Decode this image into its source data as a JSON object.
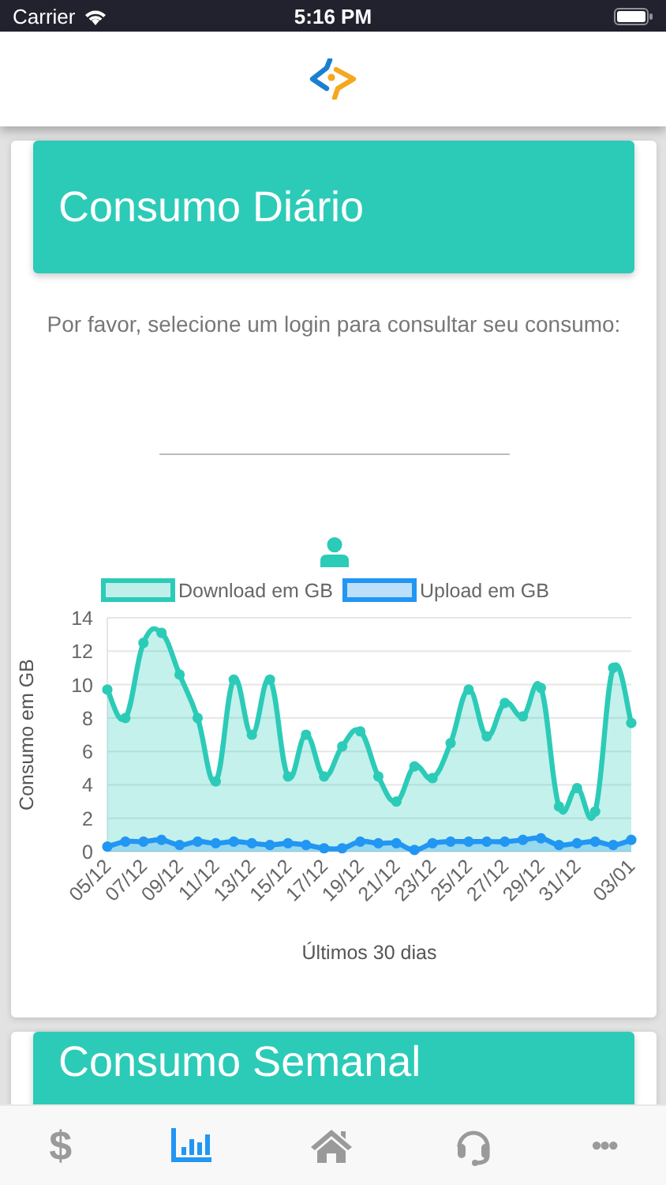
{
  "status_bar": {
    "carrier": "Carrier",
    "time": "5:16 PM"
  },
  "cards": [
    {
      "title": "Consumo Diário",
      "prompt": "Por favor, selecione um login para consultar seu consumo:",
      "chart_data": {
        "type": "area",
        "xlabel": "Últimos 30 dias",
        "ylabel": "Consumo em GB",
        "categories": [
          "05/12",
          null,
          "07/12",
          null,
          "09/12",
          null,
          "11/12",
          null,
          "13/12",
          null,
          "15/12",
          null,
          "17/12",
          null,
          "19/12",
          null,
          "21/12",
          null,
          "23/12",
          null,
          "25/12",
          null,
          "27/12",
          null,
          "29/12",
          null,
          "31/12",
          null,
          null,
          "03/01"
        ],
        "series": [
          {
            "name": "Download em GB",
            "color": "#2ccbb8",
            "values": [
              9.7,
              8.0,
              12.5,
              13.1,
              10.6,
              8.0,
              4.2,
              10.3,
              7.0,
              10.3,
              4.5,
              7.0,
              4.5,
              6.3,
              7.2,
              4.5,
              3.0,
              5.1,
              4.4,
              6.5,
              9.7,
              6.9,
              8.9,
              8.1,
              9.8,
              2.7,
              3.8,
              2.4,
              11.0,
              7.7
            ]
          },
          {
            "name": "Upload em GB",
            "color": "#2196f3",
            "values": [
              0.3,
              0.6,
              0.6,
              0.7,
              0.4,
              0.6,
              0.5,
              0.6,
              0.5,
              0.4,
              0.5,
              0.4,
              0.2,
              0.2,
              0.6,
              0.5,
              0.5,
              0.1,
              0.5,
              0.6,
              0.6,
              0.6,
              0.6,
              0.7,
              0.8,
              0.4,
              0.5,
              0.6,
              0.4,
              0.7
            ]
          }
        ],
        "ylim": [
          0,
          14
        ],
        "yticks": [
          0,
          2,
          4,
          6,
          8,
          10,
          12,
          14
        ],
        "grid": true,
        "legend": "top"
      }
    },
    {
      "title": "Consumo Semanal"
    }
  ],
  "tabs": [
    {
      "kind": "glyph",
      "label": "$",
      "selected": false
    },
    {
      "kind": "chart",
      "selected": true
    },
    {
      "kind": "home",
      "selected": false
    },
    {
      "kind": "headset",
      "selected": false
    },
    {
      "kind": "glyph",
      "label": "•••",
      "selected": false
    }
  ]
}
